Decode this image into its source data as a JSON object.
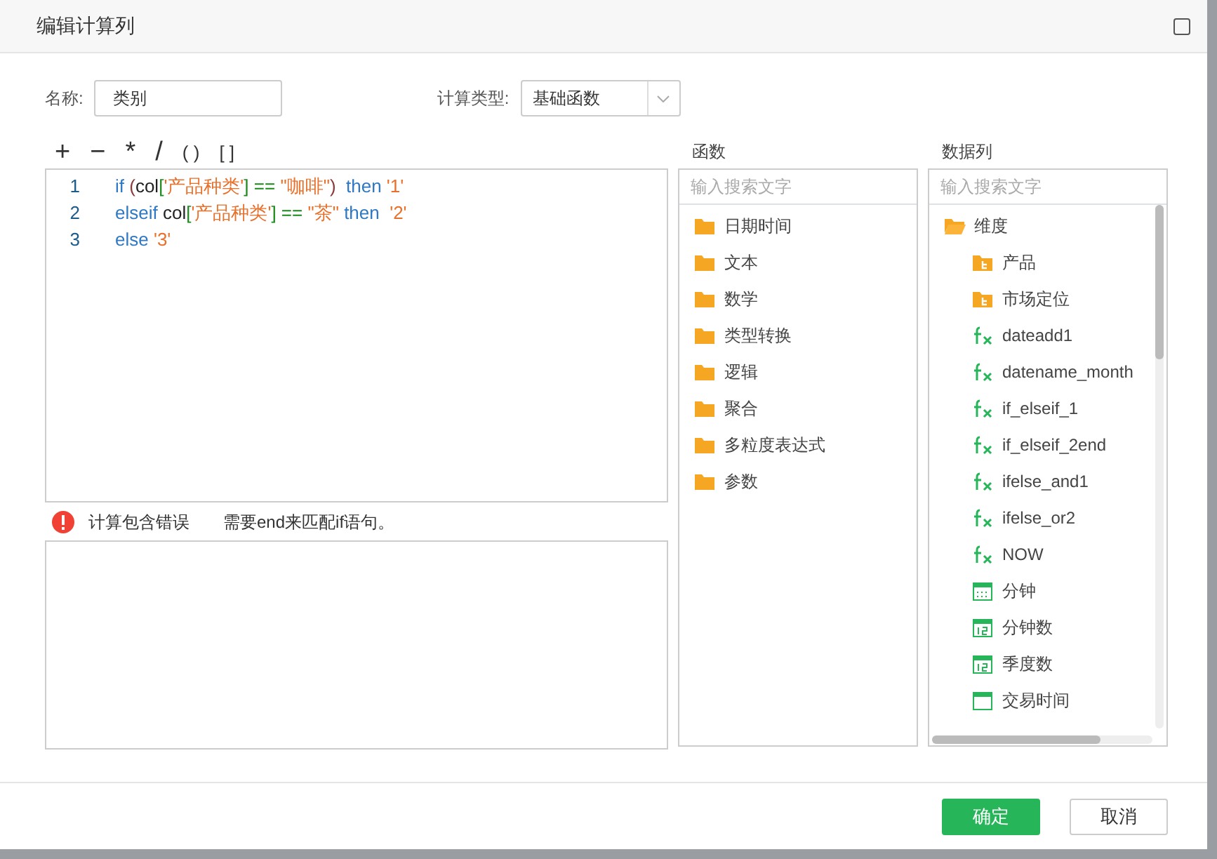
{
  "dialog": {
    "title": "编辑计算列"
  },
  "name_field": {
    "label": "名称:",
    "value": "类别"
  },
  "calc_type": {
    "label": "计算类型:",
    "value": "基础函数"
  },
  "operators": [
    "+",
    "−",
    "*",
    "/",
    "( )",
    "[ ]"
  ],
  "code_lines": [
    {
      "number": "1",
      "tokens": [
        {
          "text": "if",
          "kind": "keyword"
        },
        {
          "text": " (",
          "kind": "paren"
        },
        {
          "text": "col",
          "kind": "plain"
        },
        {
          "text": "[",
          "kind": "bracket"
        },
        {
          "text": "'产品种类'",
          "kind": "string"
        },
        {
          "text": "] ==",
          "kind": "bracket"
        },
        {
          "text": " \"咖啡\"",
          "kind": "string"
        },
        {
          "text": ")",
          "kind": "paren"
        },
        {
          "text": "  then",
          "kind": "keyword"
        },
        {
          "text": " '1'",
          "kind": "string"
        }
      ]
    },
    {
      "number": "2",
      "tokens": [
        {
          "text": "elseif",
          "kind": "keyword"
        },
        {
          "text": " col",
          "kind": "plain"
        },
        {
          "text": "[",
          "kind": "bracket"
        },
        {
          "text": "'产品种类'",
          "kind": "string"
        },
        {
          "text": "] ==",
          "kind": "bracket"
        },
        {
          "text": " \"茶\"",
          "kind": "string"
        },
        {
          "text": " then",
          "kind": "keyword"
        },
        {
          "text": "  '2'",
          "kind": "string"
        }
      ]
    },
    {
      "number": "3",
      "tokens": [
        {
          "text": "else",
          "kind": "keyword"
        },
        {
          "text": " '3'",
          "kind": "string"
        }
      ]
    }
  ],
  "error": {
    "title": "计算包含错误",
    "message": "需要end来匹配if语句。"
  },
  "functions": {
    "heading": "函数",
    "search_placeholder": "输入搜索文字",
    "items": [
      {
        "label": "日期时间"
      },
      {
        "label": "文本"
      },
      {
        "label": "数学"
      },
      {
        "label": "类型转换"
      },
      {
        "label": "逻辑"
      },
      {
        "label": "聚合"
      },
      {
        "label": "多粒度表达式"
      },
      {
        "label": "参数"
      }
    ]
  },
  "data_columns": {
    "heading": "数据列",
    "search_placeholder": "输入搜索文字",
    "items": [
      {
        "label": "维度",
        "kind": "folder",
        "expanded": true,
        "children": [
          {
            "label": "产品",
            "kind": "hierarchy"
          },
          {
            "label": "市场定位",
            "kind": "hierarchy"
          },
          {
            "label": "dateadd1",
            "kind": "formula"
          },
          {
            "label": "datename_month",
            "kind": "formula"
          },
          {
            "label": "if_elseif_1",
            "kind": "formula"
          },
          {
            "label": "if_elseif_2end",
            "kind": "formula"
          },
          {
            "label": "ifelse_and1",
            "kind": "formula"
          },
          {
            "label": "ifelse_or2",
            "kind": "formula"
          },
          {
            "label": "NOW",
            "kind": "formula"
          },
          {
            "label": "分钟",
            "kind": "datetime"
          },
          {
            "label": "分钟数",
            "kind": "date-number"
          },
          {
            "label": "季度数",
            "kind": "date-number"
          },
          {
            "label": "交易时间",
            "kind": "date"
          }
        ]
      }
    ]
  },
  "buttons": [
    {
      "label": "确定",
      "kind": "primary"
    },
    {
      "label": "取消",
      "kind": "secondary"
    }
  ]
}
